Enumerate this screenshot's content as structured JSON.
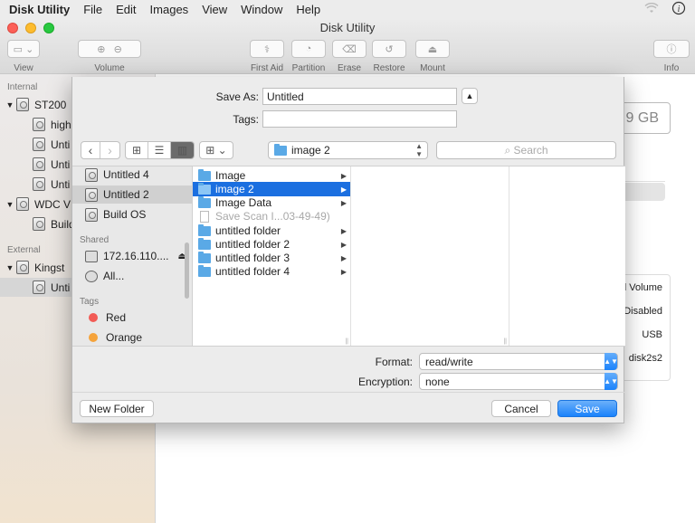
{
  "menubar": {
    "app": "Disk Utility",
    "items": [
      "File",
      "Edit",
      "Images",
      "View",
      "Window",
      "Help"
    ]
  },
  "window": {
    "title": "Disk Utility",
    "toolbar": {
      "view": "View",
      "volume": "Volume",
      "first_aid": "First Aid",
      "partition": "Partition",
      "erase": "Erase",
      "restore": "Restore",
      "mount": "Mount",
      "info": "Info"
    }
  },
  "sidebar": {
    "internal_header": "Internal",
    "external_header": "External",
    "items": [
      "ST200",
      "high",
      "Unti",
      "Unti",
      "Unti",
      "WDC V",
      "Build",
      "Kingst",
      "Unti"
    ]
  },
  "main": {
    "capacity": "9 GB",
    "info_values": [
      "al Volume",
      "Disabled",
      "USB",
      "disk2s2"
    ]
  },
  "sheet": {
    "save_as_label": "Save As:",
    "save_as_value": "Untitled",
    "tags_label": "Tags:",
    "location": "image 2",
    "search_placeholder": "Search",
    "sidebar_items": [
      "Untitled 4",
      "Untitled 2",
      "Build OS"
    ],
    "shared_header": "Shared",
    "shared_items": [
      "172.16.110....",
      "All..."
    ],
    "tags_header": "Tags",
    "tags": [
      {
        "label": "Red",
        "color": "#f25b55"
      },
      {
        "label": "Orange",
        "color": "#f5a33b"
      }
    ],
    "files": [
      "Image",
      "image 2",
      "Image Data",
      "Save Scan I...03-49-49)",
      "untitled folder",
      "untitled folder 2",
      "untitled folder 3",
      "untitled folder 4"
    ],
    "format_label": "Format:",
    "format_value": "read/write",
    "encryption_label": "Encryption:",
    "encryption_value": "none",
    "new_folder": "New Folder",
    "cancel": "Cancel",
    "save": "Save"
  }
}
